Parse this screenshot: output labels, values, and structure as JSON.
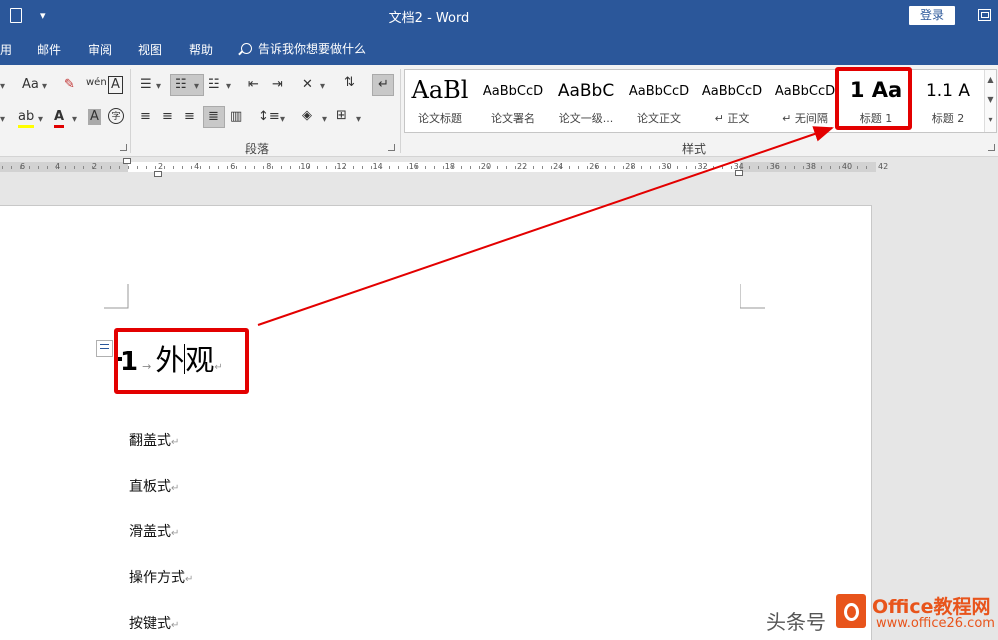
{
  "window": {
    "title": "文档2 - Word",
    "login_label": "登录"
  },
  "tabs": [
    {
      "label": "用"
    },
    {
      "label": "邮件"
    },
    {
      "label": "审阅"
    },
    {
      "label": "视图"
    },
    {
      "label": "帮助"
    }
  ],
  "tell_me": "告诉我你想要做什么",
  "ribbon": {
    "paragraph_group_label": "段落",
    "styles_group_label": "样式",
    "font_icons": [
      "Aa",
      "A",
      "A"
    ],
    "styles": [
      {
        "preview": "AaBl",
        "name": "论文标题"
      },
      {
        "preview": "AaBbCcD",
        "name": "论文署名"
      },
      {
        "preview": "AaBbC",
        "name": "论文一级..."
      },
      {
        "preview": "AaBbCcD",
        "name": "论文正文"
      },
      {
        "preview": "AaBbCcD",
        "name": "↵ 正文"
      },
      {
        "preview": "AaBbCcD",
        "name": "↵ 无间隔"
      },
      {
        "preview": "1  Aa",
        "name": "标题 1"
      },
      {
        "preview": "1.1  A",
        "name": "标题 2"
      }
    ]
  },
  "ruler": {
    "left_numbers": [
      "6",
      "4",
      "2"
    ],
    "numbers": [
      "2",
      "4",
      "6",
      "8",
      "10",
      "12",
      "14",
      "16",
      "18",
      "20",
      "22",
      "24",
      "26",
      "28",
      "30",
      "32",
      "34",
      "36",
      "38",
      "40",
      "42"
    ]
  },
  "document": {
    "heading_number": "1",
    "heading_text_a": "外",
    "heading_text_b": "观",
    "paragraph_mark": "↵",
    "body_lines": [
      "翻盖式",
      "直板式",
      "滑盖式",
      "操作方式",
      "按键式"
    ]
  },
  "watermark": {
    "text_left": "头条号",
    "brand": "Office教程网",
    "url": "www.office26.com"
  },
  "colors": {
    "word_blue": "#2b579a",
    "highlight_red": "#e30000"
  }
}
